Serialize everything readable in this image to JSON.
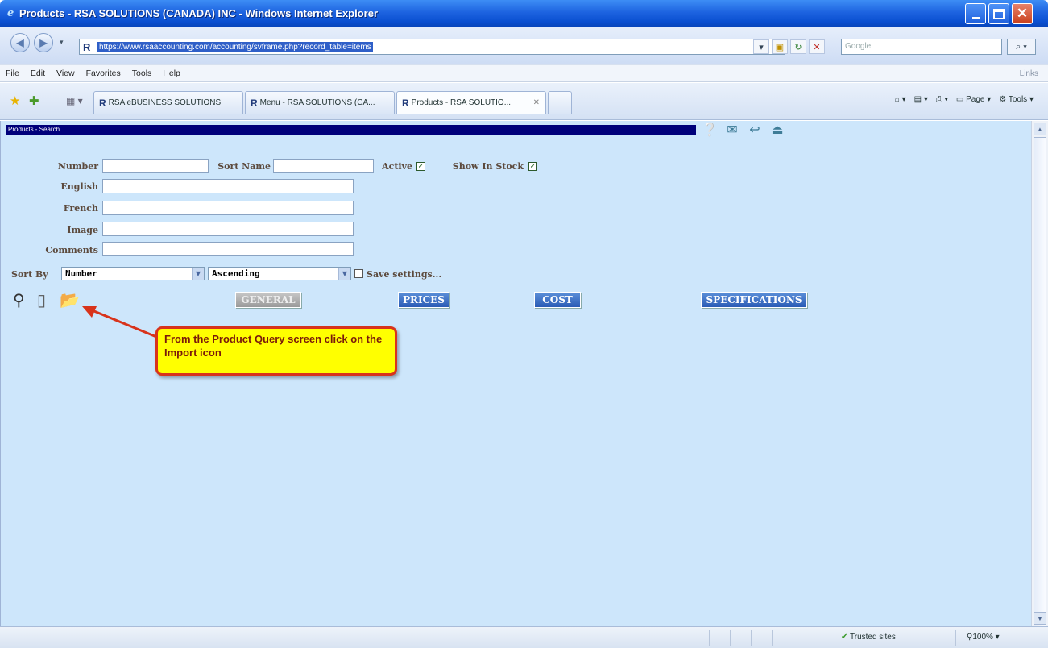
{
  "window": {
    "title": "Products - RSA SOLUTIONS (CANADA) INC - Windows Internet Explorer"
  },
  "address_bar": {
    "url": "https://www.rsaaccounting.com/accounting/svframe.php?record_table=items",
    "search_placeholder": "Google"
  },
  "menu": {
    "items": [
      "File",
      "Edit",
      "View",
      "Favorites",
      "Tools",
      "Help"
    ],
    "links_label": "Links"
  },
  "tabs": [
    {
      "label": "RSA eBUSINESS SOLUTIONS"
    },
    {
      "label": "Menu - RSA SOLUTIONS (CA..."
    },
    {
      "label": "Products - RSA SOLUTIO..."
    }
  ],
  "toolbar": {
    "page_label": "Page",
    "tools_label": "Tools"
  },
  "page": {
    "header": "Products - Search...",
    "form": {
      "number_label": "Number",
      "sort_name_label": "Sort Name",
      "active_label": "Active",
      "active_checked": true,
      "show_in_stock_label": "Show In Stock",
      "show_in_stock_checked": true,
      "english_label": "English",
      "french_label": "French",
      "image_label": "Image",
      "comments_label": "Comments",
      "sort_by_label": "Sort By",
      "sort_by_value": "Number",
      "order_value": "Ascending",
      "save_settings_label": "Save settings..."
    },
    "tab_buttons": [
      "GENERAL",
      "PRICES",
      "COST",
      "SPECIFICATIONS"
    ],
    "callout": "From the Product Query screen click on the Import icon"
  },
  "status_bar": {
    "zone": "Trusted sites",
    "zoom": "100%"
  },
  "colors": {
    "page_bg": "#cde6fb",
    "header_bar": "#00007a",
    "tab_button": "#2b5cb6",
    "callout_bg": "#ffff00",
    "callout_border": "#d8331b"
  }
}
